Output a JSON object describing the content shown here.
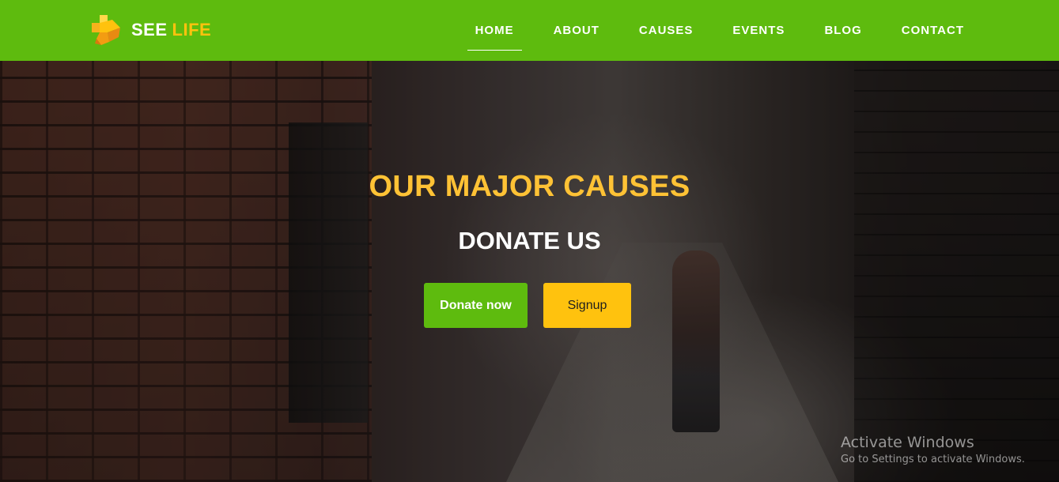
{
  "brand": {
    "name_primary": "SEE",
    "name_accent": "LIFE",
    "logo_icon": "cross-cube-logo-icon",
    "colors": {
      "primary_green": "#5ebb0e",
      "accent_yellow": "#ffc20e",
      "title_gold": "#ffc235"
    }
  },
  "nav": {
    "items": [
      {
        "label": "HOME",
        "active": true
      },
      {
        "label": "ABOUT"
      },
      {
        "label": "CAUSES"
      },
      {
        "label": "EVENTS"
      },
      {
        "label": "BLOG"
      },
      {
        "label": "CONTACT"
      }
    ]
  },
  "hero": {
    "title": "OUR MAJOR CAUSES",
    "subtitle": "DONATE US",
    "primary_button": "Donate now",
    "secondary_button": "Signup"
  },
  "os_watermark": {
    "title": "Activate Windows",
    "subtitle": "Go to Settings to activate Windows."
  }
}
